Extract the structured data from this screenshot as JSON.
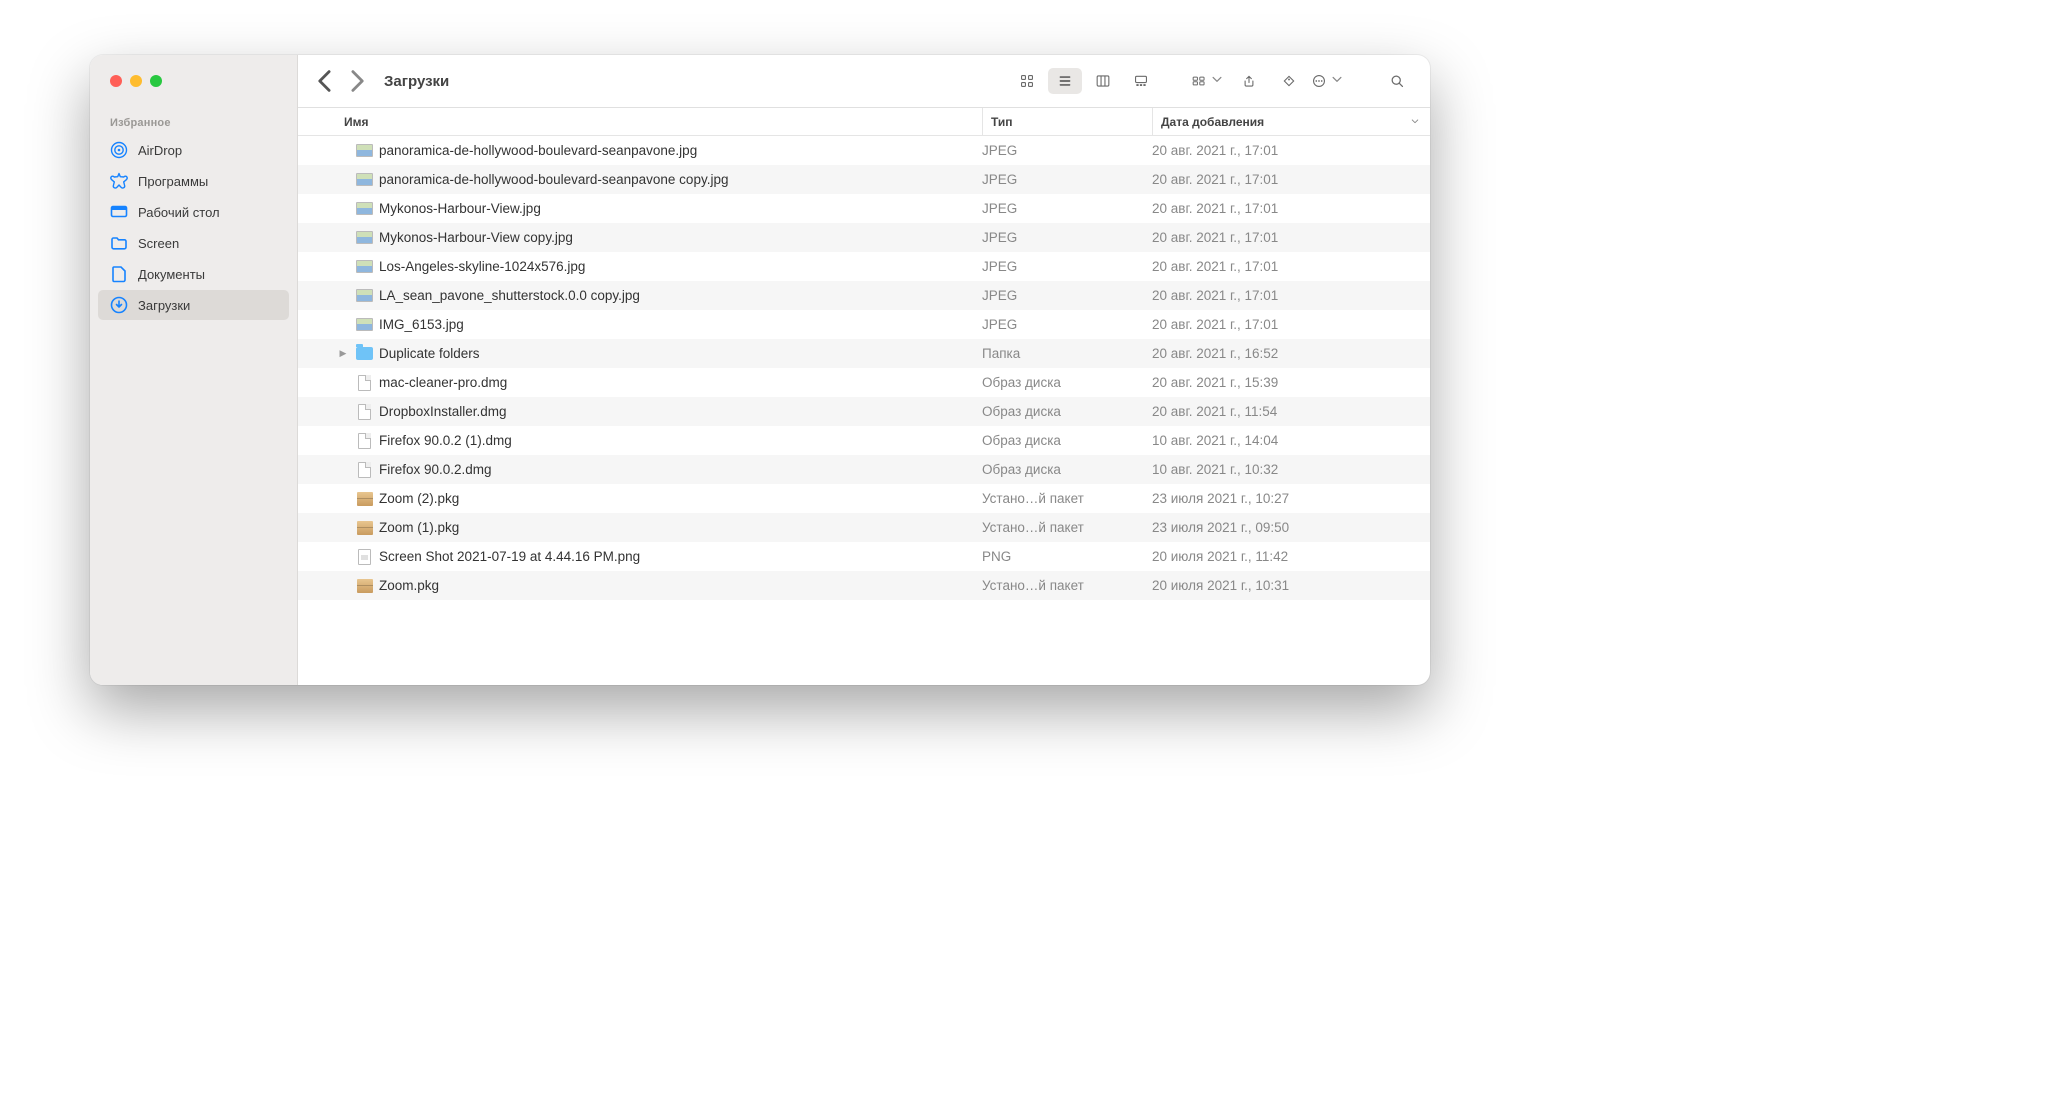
{
  "sidebar": {
    "section_label": "Избранное",
    "items": [
      {
        "label": "AirDrop",
        "icon": "airdrop",
        "active": false
      },
      {
        "label": "Программы",
        "icon": "apps",
        "active": false
      },
      {
        "label": "Рабочий стол",
        "icon": "desktop",
        "active": false
      },
      {
        "label": "Screen",
        "icon": "folder",
        "active": false
      },
      {
        "label": "Документы",
        "icon": "documents",
        "active": false
      },
      {
        "label": "Загрузки",
        "icon": "downloads",
        "active": true
      }
    ]
  },
  "toolbar": {
    "title": "Загрузки"
  },
  "columns": {
    "name": "Имя",
    "type": "Тип",
    "date": "Дата добавления"
  },
  "rows": [
    {
      "name": "panoramica-de-hollywood-boulevard-seanpavone.jpg",
      "type": "JPEG",
      "date": "20 авг. 2021 г., 17:01",
      "icon": "img",
      "folder": false
    },
    {
      "name": "panoramica-de-hollywood-boulevard-seanpavone copy.jpg",
      "type": "JPEG",
      "date": "20 авг. 2021 г., 17:01",
      "icon": "img",
      "folder": false
    },
    {
      "name": "Mykonos-Harbour-View.jpg",
      "type": "JPEG",
      "date": "20 авг. 2021 г., 17:01",
      "icon": "img",
      "folder": false
    },
    {
      "name": "Mykonos-Harbour-View copy.jpg",
      "type": "JPEG",
      "date": "20 авг. 2021 г., 17:01",
      "icon": "img",
      "folder": false
    },
    {
      "name": "Los-Angeles-skyline-1024x576.jpg",
      "type": "JPEG",
      "date": "20 авг. 2021 г., 17:01",
      "icon": "img",
      "folder": false
    },
    {
      "name": "LA_sean_pavone_shutterstock.0.0 copy.jpg",
      "type": "JPEG",
      "date": "20 авг. 2021 г., 17:01",
      "icon": "img",
      "folder": false
    },
    {
      "name": "IMG_6153.jpg",
      "type": "JPEG",
      "date": "20 авг. 2021 г., 17:01",
      "icon": "img",
      "folder": false
    },
    {
      "name": "Duplicate folders",
      "type": "Папка",
      "date": "20 авг. 2021 г., 16:52",
      "icon": "folder",
      "folder": true
    },
    {
      "name": "mac-cleaner-pro.dmg",
      "type": "Образ диска",
      "date": "20 авг. 2021 г., 15:39",
      "icon": "dmg",
      "folder": false
    },
    {
      "name": "DropboxInstaller.dmg",
      "type": "Образ диска",
      "date": "20 авг. 2021 г., 11:54",
      "icon": "dmg",
      "folder": false
    },
    {
      "name": "Firefox 90.0.2 (1).dmg",
      "type": "Образ диска",
      "date": "10 авг. 2021 г., 14:04",
      "icon": "dmg",
      "folder": false
    },
    {
      "name": "Firefox 90.0.2.dmg",
      "type": "Образ диска",
      "date": "10 авг. 2021 г., 10:32",
      "icon": "dmg",
      "folder": false
    },
    {
      "name": "Zoom (2).pkg",
      "type": "Устано…й пакет",
      "date": "23 июля 2021 г., 10:27",
      "icon": "pkg",
      "folder": false
    },
    {
      "name": "Zoom (1).pkg",
      "type": "Устано…й пакет",
      "date": "23 июля 2021 г., 09:50",
      "icon": "pkg",
      "folder": false
    },
    {
      "name": "Screen Shot 2021-07-19 at 4.44.16 PM.png",
      "type": "PNG",
      "date": "20 июля 2021 г., 11:42",
      "icon": "png",
      "folder": false
    },
    {
      "name": "Zoom.pkg",
      "type": "Устано…й пакет",
      "date": "20 июля 2021 г., 10:31",
      "icon": "pkg",
      "folder": false
    }
  ]
}
